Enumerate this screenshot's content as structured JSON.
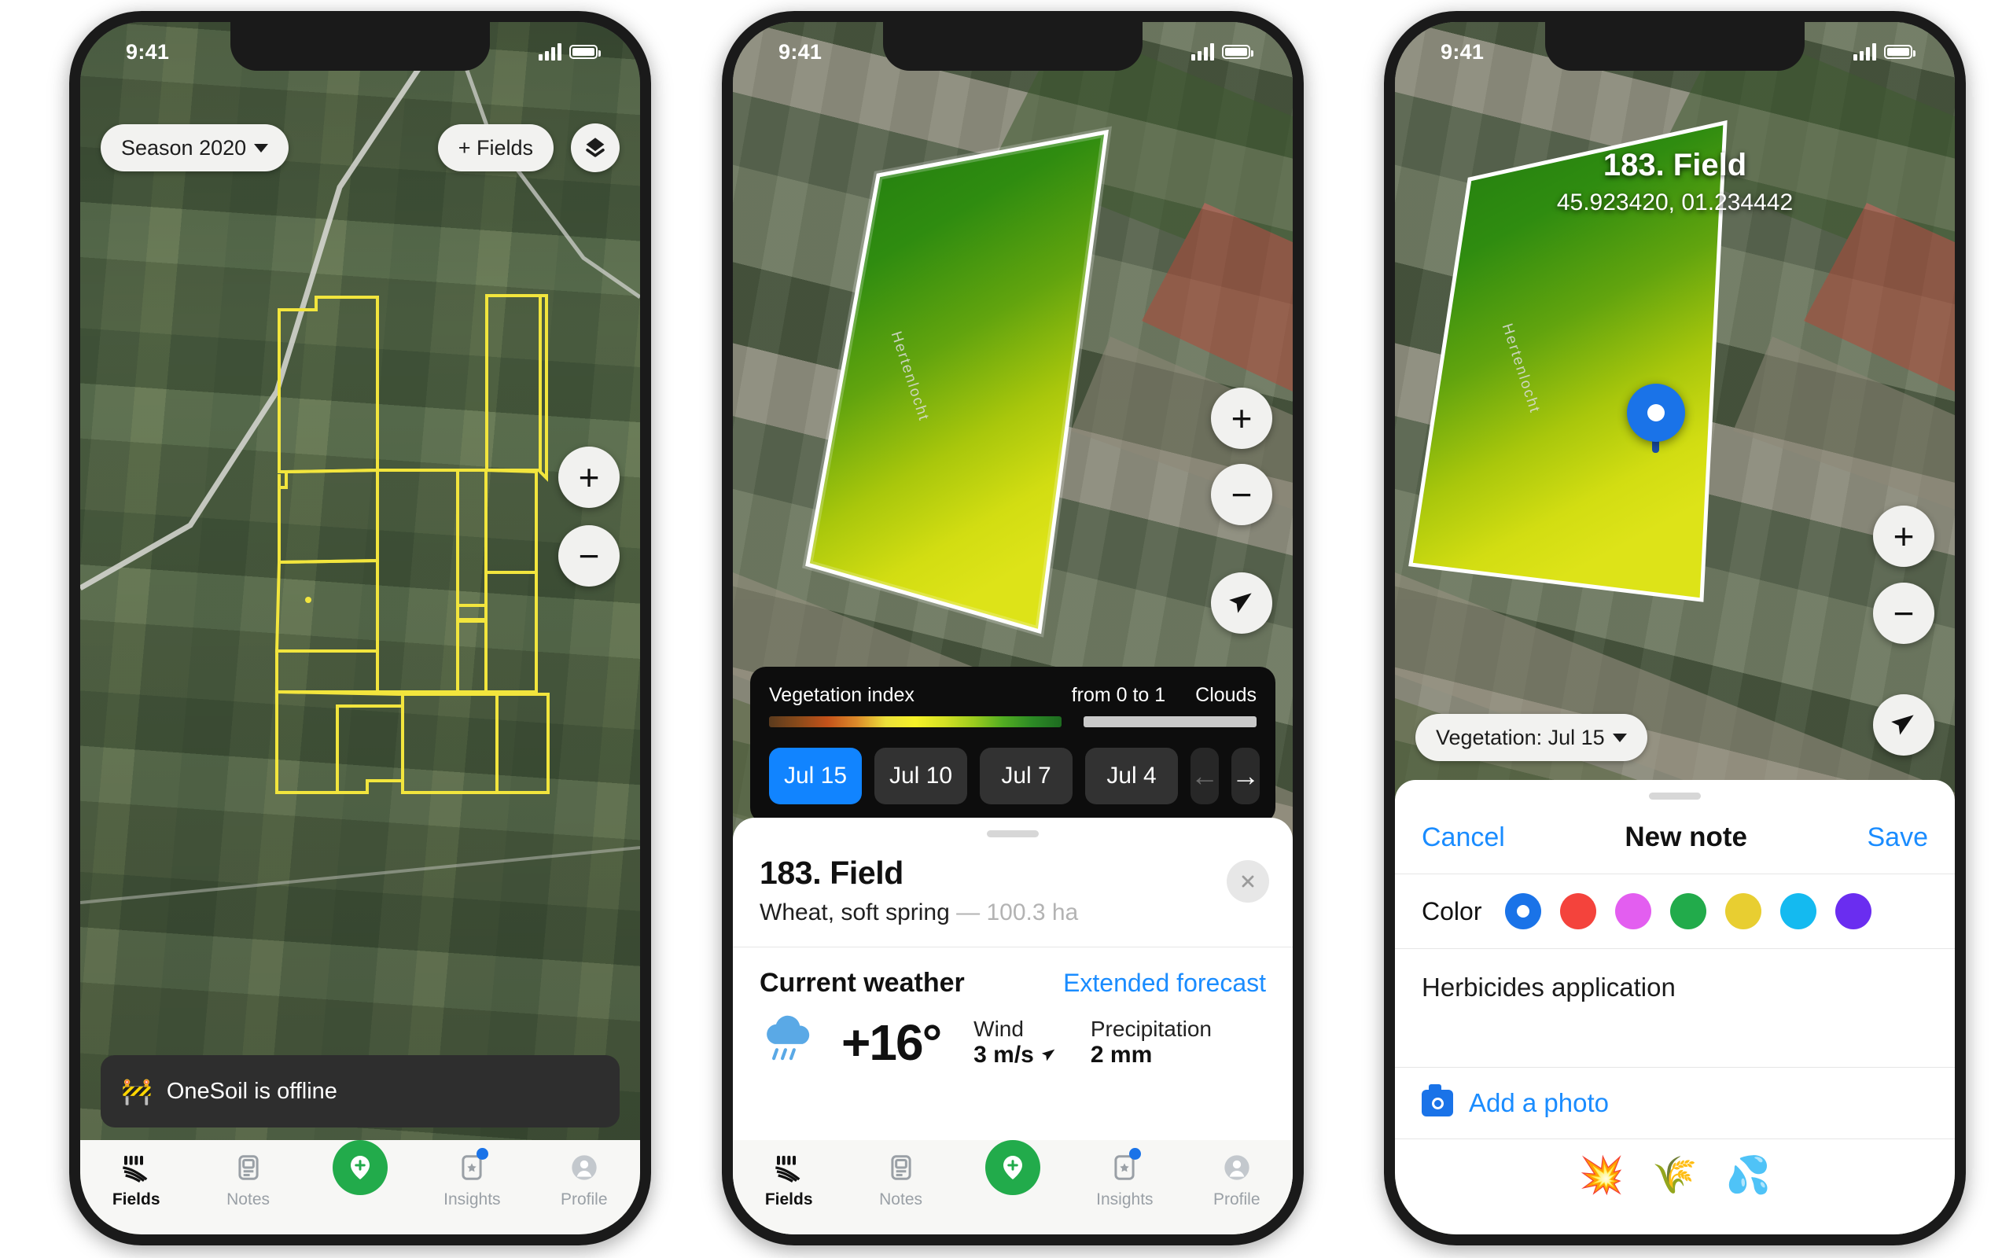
{
  "app": {
    "name": "OneSoil"
  },
  "status_bar": {
    "time": "9:41"
  },
  "phone1": {
    "season_button": "Season 2020",
    "add_fields_button": "+ Fields",
    "layers_icon": "layers-icon",
    "zoom_in": "+",
    "zoom_out": "−",
    "offline_toast": {
      "icon": "barrier-emoji",
      "text": "OneSoil is offline"
    },
    "tabs": [
      {
        "label": "Fields",
        "icon": "fields-icon",
        "active": true,
        "badge": false
      },
      {
        "label": "Notes",
        "icon": "notes-icon",
        "active": false,
        "badge": false
      },
      {
        "label": "",
        "icon": "add-pin-fab",
        "active": false,
        "badge": false
      },
      {
        "label": "Insights",
        "icon": "insights-icon",
        "active": false,
        "badge": true
      },
      {
        "label": "Profile",
        "icon": "profile-icon",
        "active": false,
        "badge": false
      }
    ]
  },
  "phone2": {
    "road_label": "Hertenlocht",
    "zoom_in": "+",
    "zoom_out": "−",
    "locate_icon": "navigation-arrow-icon",
    "legend": {
      "title": "Vegetation index",
      "range": "from 0 to 1",
      "clouds": "Clouds",
      "dates": [
        "Jul 15",
        "Jul 10",
        "Jul 7",
        "Jul 4"
      ],
      "selected_date": "Jul 15",
      "prev_arrow": "←",
      "next_arrow": "→"
    },
    "field_card": {
      "title": "183. Field",
      "crop": "Wheat, soft spring",
      "dash": "—",
      "area": "100.3 ha",
      "close_icon": "close-icon"
    },
    "weather": {
      "title": "Current weather",
      "link": "Extended forecast",
      "icon": "rain-cloud-icon",
      "temperature": "+16°",
      "wind_label": "Wind",
      "wind_value": "3 m/s",
      "precip_label": "Precipitation",
      "precip_value": "2 mm"
    },
    "tabs": [
      {
        "label": "Fields",
        "icon": "fields-icon",
        "active": true,
        "badge": false
      },
      {
        "label": "Notes",
        "icon": "notes-icon",
        "active": false,
        "badge": false
      },
      {
        "label": "",
        "icon": "add-pin-fab",
        "active": false,
        "badge": false
      },
      {
        "label": "Insights",
        "icon": "insights-icon",
        "active": false,
        "badge": true
      },
      {
        "label": "Profile",
        "icon": "profile-icon",
        "active": false,
        "badge": false
      }
    ]
  },
  "phone3": {
    "field_name": "183. Field",
    "coordinates": "45.923420, 01.234442",
    "road_label": "Hertenlocht",
    "vegetation_button": "Vegetation: Jul 15",
    "zoom_in": "+",
    "zoom_out": "−",
    "locate_icon": "navigation-arrow-icon",
    "note": {
      "cancel": "Cancel",
      "title": "New note",
      "save": "Save",
      "color_label": "Color",
      "colors": [
        "#1a73e8",
        "#f4433c",
        "#e35ef0",
        "#22ab4b",
        "#e8ce31",
        "#14baf0",
        "#6a2df0"
      ],
      "selected_color_index": 0,
      "text": "Herbicides application",
      "add_photo": "Add a photo",
      "emojis": [
        "💥",
        "🌾",
        "💦"
      ]
    }
  },
  "chart_data": {
    "type": "heatmap",
    "title": "Vegetation index",
    "scale_label": "from 0 to 1",
    "range": [
      0,
      1
    ],
    "colors": [
      "#5a3a1d",
      "#8a4a1a",
      "#c4521a",
      "#dc8a2a",
      "#ece03a",
      "#f5f128",
      "#d4e024",
      "#9ccb1e",
      "#52ad22",
      "#2c8a25",
      "#1d6b20"
    ],
    "dates": [
      "Jul 15",
      "Jul 10",
      "Jul 7",
      "Jul 4"
    ],
    "selected_date": "Jul 15"
  }
}
